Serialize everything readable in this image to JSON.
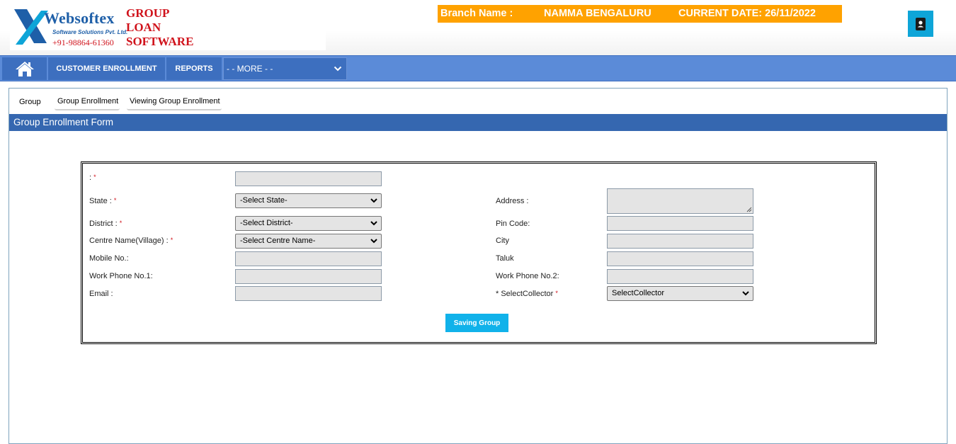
{
  "header": {
    "brand": "Websoftex",
    "brand_sub": "Software Solutions Pvt. Ltd.",
    "phone": "+91-98864-61360",
    "product": [
      "GROUP",
      "LOAN",
      "SOFTWARE"
    ],
    "branch_label": "Branch Name :",
    "branch_value": "NAMMA BENGALURU",
    "date_label": "CURRENT DATE: 26/11/2022",
    "accent_orange": "#ffa200",
    "profile_icon": "contact-card-icon"
  },
  "nav": {
    "home_icon": "home-icon",
    "customer_enrollment": "CUSTOMER ENROLLMENT",
    "reports": "REPORTS",
    "more": "- - MORE - -",
    "bar_color": "#5b8bd8"
  },
  "tabs": {
    "lead": "Group",
    "items": [
      "Group Enrollment",
      "Viewing Group Enrollment"
    ]
  },
  "form": {
    "title": "Group Enrollment Form",
    "top_label": ":",
    "left": [
      {
        "label": "State :",
        "required": true,
        "type": "select",
        "value": "-Select State-"
      },
      {
        "label": "District :",
        "required": true,
        "type": "select",
        "value": "-Select District-"
      },
      {
        "label": "Centre Name(Village) :",
        "required": true,
        "type": "select",
        "value": "-Select Centre Name-"
      },
      {
        "label": "Mobile No.:",
        "required": false,
        "type": "input",
        "value": ""
      },
      {
        "label": "Work Phone No.1:",
        "required": false,
        "type": "input",
        "value": ""
      },
      {
        "label": "Email :",
        "required": false,
        "type": "input",
        "value": ""
      }
    ],
    "right": [
      {
        "label": "Address :",
        "required": false,
        "type": "textarea",
        "value": ""
      },
      {
        "label": "Pin Code:",
        "required": false,
        "type": "input",
        "value": ""
      },
      {
        "label": "City",
        "required": false,
        "type": "input",
        "value": ""
      },
      {
        "label": "Taluk",
        "required": false,
        "type": "input",
        "value": ""
      },
      {
        "label": "Work Phone No.2:",
        "required": false,
        "type": "input",
        "value": ""
      },
      {
        "label": "* SelectCollector",
        "required": true,
        "type": "select",
        "value": "SelectCollector"
      }
    ],
    "save_button": "Saving Group",
    "button_color": "#11b2ea"
  }
}
